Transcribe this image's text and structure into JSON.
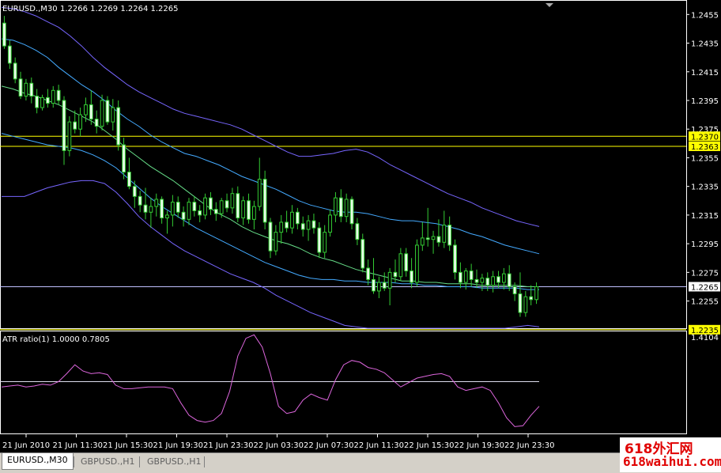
{
  "header": {
    "symbol_label": "EURUSD.,M30",
    "ohlc_text": "1.2266 1.2269 1.2264 1.2265"
  },
  "indicator": {
    "label": "ATR ratio(1) 1.0000 0.7805",
    "axis_label": "1.4104"
  },
  "price_axis": {
    "ticks": [
      "1.2455",
      "1.2435",
      "1.2415",
      "1.2395",
      "1.2375",
      "1.2355",
      "1.2335",
      "1.2315",
      "1.2295",
      "1.2275",
      "1.2255"
    ],
    "ylim": [
      1.2236,
      1.2464
    ]
  },
  "time_axis": {
    "labels": [
      "21 Jun 2010",
      "21 Jun 11:30",
      "21 Jun 15:30",
      "21 Jun 19:30",
      "21 Jun 23:30",
      "22 Jun 03:30",
      "22 Jun 07:30",
      "22 Jun 11:30",
      "22 Jun 15:30",
      "22 Jun 19:30",
      "22 Jun 23:30"
    ]
  },
  "horizontal_levels": [
    {
      "value": 1.237,
      "label": "1.2370",
      "color": "#ffff00"
    },
    {
      "value": 1.2363,
      "label": "1.2363",
      "color": "#ffff00"
    },
    {
      "value": 1.2265,
      "label": "1.2265",
      "color": "#c0c0ff"
    },
    {
      "value": 1.2235,
      "label": "1.2235",
      "color": "#ffff00"
    }
  ],
  "colors": {
    "background": "#000000",
    "candle_bull": "#000000",
    "candle_bear": "#e8ffe8",
    "wick": "#33cc33",
    "band_mid": "#66dd88",
    "band_inner": "#44aaff",
    "band_outer": "#7766ff",
    "indicator_line": "#dd66dd",
    "indicator_level": "#ddddee",
    "axis_text": "#ffffff"
  },
  "chart_data": {
    "type": "candlestick",
    "ylim": [
      1.2236,
      1.2464
    ],
    "candles": [
      [
        1.2449,
        1.2454,
        1.2431,
        1.2433
      ],
      [
        1.2433,
        1.2437,
        1.2417,
        1.2421
      ],
      [
        1.2421,
        1.2425,
        1.2407,
        1.241
      ],
      [
        1.241,
        1.2415,
        1.2396,
        1.2398
      ],
      [
        1.2398,
        1.241,
        1.2395,
        1.2407
      ],
      [
        1.2407,
        1.2411,
        1.2393,
        1.2398
      ],
      [
        1.2398,
        1.2403,
        1.2386,
        1.239
      ],
      [
        1.239,
        1.2399,
        1.2388,
        1.2397
      ],
      [
        1.2397,
        1.2403,
        1.239,
        1.2393
      ],
      [
        1.2393,
        1.2405,
        1.239,
        1.2402
      ],
      [
        1.2402,
        1.2406,
        1.2392,
        1.2395
      ],
      [
        1.2395,
        1.2398,
        1.235,
        1.236
      ],
      [
        1.236,
        1.2384,
        1.2356,
        1.238
      ],
      [
        1.238,
        1.2388,
        1.2372,
        1.2375
      ],
      [
        1.2375,
        1.239,
        1.237,
        1.2385
      ],
      [
        1.2385,
        1.2397,
        1.238,
        1.2392
      ],
      [
        1.2392,
        1.2402,
        1.2378,
        1.2382
      ],
      [
        1.2382,
        1.2388,
        1.2372,
        1.2377
      ],
      [
        1.2377,
        1.2399,
        1.2374,
        1.2395
      ],
      [
        1.2395,
        1.2398,
        1.2378,
        1.238
      ],
      [
        1.238,
        1.2396,
        1.2374,
        1.239
      ],
      [
        1.239,
        1.2395,
        1.236,
        1.2364
      ],
      [
        1.2364,
        1.2369,
        1.234,
        1.2345
      ],
      [
        1.2345,
        1.2355,
        1.2333,
        1.2335
      ],
      [
        1.2335,
        1.2339,
        1.232,
        1.2328
      ],
      [
        1.2328,
        1.2332,
        1.2317,
        1.2322
      ],
      [
        1.2322,
        1.2334,
        1.2312,
        1.2317
      ],
      [
        1.2317,
        1.2327,
        1.2306,
        1.2321
      ],
      [
        1.2321,
        1.233,
        1.2314,
        1.2326
      ],
      [
        1.2326,
        1.2328,
        1.2309,
        1.2313
      ],
      [
        1.2313,
        1.2318,
        1.2302,
        1.2315
      ],
      [
        1.2315,
        1.2329,
        1.2307,
        1.2324
      ],
      [
        1.2324,
        1.2328,
        1.2313,
        1.2317
      ],
      [
        1.2317,
        1.2321,
        1.2307,
        1.2312
      ],
      [
        1.2312,
        1.2327,
        1.2308,
        1.2324
      ],
      [
        1.2324,
        1.2328,
        1.2314,
        1.2318
      ],
      [
        1.2318,
        1.2322,
        1.231,
        1.2315
      ],
      [
        1.2315,
        1.233,
        1.2312,
        1.2327
      ],
      [
        1.2327,
        1.2331,
        1.2315,
        1.2319
      ],
      [
        1.2319,
        1.2324,
        1.2311,
        1.2316
      ],
      [
        1.2316,
        1.2327,
        1.2313,
        1.2325
      ],
      [
        1.2325,
        1.233,
        1.2317,
        1.232
      ],
      [
        1.232,
        1.2334,
        1.2316,
        1.233
      ],
      [
        1.233,
        1.2335,
        1.231,
        1.2313
      ],
      [
        1.2313,
        1.2328,
        1.2308,
        1.2325
      ],
      [
        1.2325,
        1.233,
        1.2309,
        1.2312
      ],
      [
        1.2312,
        1.2325,
        1.2305,
        1.2321
      ],
      [
        1.2321,
        1.2355,
        1.2318,
        1.234
      ],
      [
        1.234,
        1.2346,
        1.2305,
        1.231
      ],
      [
        1.231,
        1.2313,
        1.2285,
        1.229
      ],
      [
        1.229,
        1.2308,
        1.2287,
        1.2303
      ],
      [
        1.2303,
        1.2315,
        1.2295,
        1.231
      ],
      [
        1.231,
        1.2318,
        1.2303,
        1.2306
      ],
      [
        1.2306,
        1.2322,
        1.2302,
        1.2317
      ],
      [
        1.2317,
        1.232,
        1.2305,
        1.2309
      ],
      [
        1.2309,
        1.2314,
        1.23,
        1.2305
      ],
      [
        1.2305,
        1.2315,
        1.2297,
        1.2311
      ],
      [
        1.2311,
        1.2316,
        1.2302,
        1.2306
      ],
      [
        1.2306,
        1.231,
        1.2285,
        1.2289
      ],
      [
        1.2289,
        1.2308,
        1.2285,
        1.2303
      ],
      [
        1.2303,
        1.2319,
        1.23,
        1.2315
      ],
      [
        1.2315,
        1.2331,
        1.231,
        1.2327
      ],
      [
        1.2327,
        1.2333,
        1.231,
        1.2314
      ],
      [
        1.2314,
        1.233,
        1.231,
        1.2326
      ],
      [
        1.2326,
        1.2328,
        1.2305,
        1.2309
      ],
      [
        1.2309,
        1.2313,
        1.2294,
        1.2298
      ],
      [
        1.2298,
        1.2302,
        1.2275,
        1.2278
      ],
      [
        1.2278,
        1.2284,
        1.2266,
        1.227
      ],
      [
        1.227,
        1.2285,
        1.226,
        1.2262
      ],
      [
        1.2262,
        1.2272,
        1.2257,
        1.2268
      ],
      [
        1.2268,
        1.2275,
        1.2262,
        1.2264
      ],
      [
        1.2264,
        1.2278,
        1.2252,
        1.2275
      ],
      [
        1.2275,
        1.2284,
        1.2268,
        1.2272
      ],
      [
        1.2272,
        1.2292,
        1.2269,
        1.2288
      ],
      [
        1.2288,
        1.2292,
        1.2272,
        1.2276
      ],
      [
        1.2276,
        1.2285,
        1.2264,
        1.2268
      ],
      [
        1.2268,
        1.2298,
        1.2265,
        1.2294
      ],
      [
        1.2294,
        1.231,
        1.229,
        1.2299
      ],
      [
        1.2299,
        1.232,
        1.2293,
        1.2298
      ],
      [
        1.2298,
        1.2304,
        1.2288,
        1.23
      ],
      [
        1.23,
        1.2312,
        1.2293,
        1.2296
      ],
      [
        1.2296,
        1.2318,
        1.2292,
        1.2308
      ],
      [
        1.2308,
        1.2314,
        1.229,
        1.2294
      ],
      [
        1.2294,
        1.2298,
        1.227,
        1.2275
      ],
      [
        1.2275,
        1.2282,
        1.2264,
        1.2268
      ],
      [
        1.2268,
        1.2278,
        1.2263,
        1.2276
      ],
      [
        1.2276,
        1.2281,
        1.2265,
        1.227
      ],
      [
        1.227,
        1.2277,
        1.2264,
        1.2268
      ],
      [
        1.2268,
        1.2274,
        1.2262,
        1.2271
      ],
      [
        1.2271,
        1.2275,
        1.2262,
        1.2266
      ],
      [
        1.2266,
        1.2276,
        1.2261,
        1.2272
      ],
      [
        1.2272,
        1.2276,
        1.2264,
        1.2268
      ],
      [
        1.2268,
        1.2278,
        1.2263,
        1.2274
      ],
      [
        1.2274,
        1.228,
        1.2262,
        1.2265
      ],
      [
        1.2265,
        1.2268,
        1.2255,
        1.226
      ],
      [
        1.226,
        1.2275,
        1.2244,
        1.2247
      ],
      [
        1.2247,
        1.2262,
        1.2244,
        1.2258
      ],
      [
        1.2258,
        1.2266,
        1.2252,
        1.2256
      ],
      [
        1.2256,
        1.2268,
        1.2253,
        1.2265
      ]
    ],
    "bands": {
      "mid": [
        1.2405,
        1.2403,
        1.24,
        1.2398,
        1.2395,
        1.2392,
        1.2388,
        1.2384,
        1.238,
        1.2374,
        1.2368,
        1.2361,
        1.2355,
        1.2349,
        1.2344,
        1.2339,
        1.2333,
        1.2327,
        1.2321,
        1.2316,
        1.2312,
        1.2307,
        1.2303,
        1.23,
        1.2297,
        1.2295,
        1.2292,
        1.2288,
        1.2285,
        1.2283,
        1.228,
        1.2277,
        1.2275,
        1.2273,
        1.2271,
        1.2269,
        1.2269,
        1.2268,
        1.2268,
        1.2267,
        1.2267,
        1.2267,
        1.2266,
        1.2266,
        1.2266,
        1.2266,
        1.2265,
        1.2265
      ],
      "upper_inner": [
        1.2438,
        1.2437,
        1.2434,
        1.243,
        1.2425,
        1.2418,
        1.2412,
        1.2406,
        1.2401,
        1.2395,
        1.2388,
        1.2382,
        1.2377,
        1.2371,
        1.2366,
        1.2362,
        1.2358,
        1.2356,
        1.2353,
        1.235,
        1.2346,
        1.2342,
        1.2339,
        1.2336,
        1.2333,
        1.2329,
        1.2325,
        1.2322,
        1.232,
        1.2318,
        1.2317,
        1.2317,
        1.2316,
        1.2314,
        1.2312,
        1.2311,
        1.2311,
        1.231,
        1.2309,
        1.2307,
        1.2305,
        1.2302,
        1.23,
        1.2297,
        1.2294,
        1.2292,
        1.229,
        1.2288
      ],
      "lower_inner": [
        1.2372,
        1.237,
        1.2368,
        1.2366,
        1.2364,
        1.2363,
        1.2362,
        1.236,
        1.2357,
        1.2353,
        1.2348,
        1.2341,
        1.2334,
        1.2327,
        1.2321,
        1.2316,
        1.2311,
        1.2306,
        1.2302,
        1.2298,
        1.2294,
        1.229,
        1.2286,
        1.2282,
        1.2279,
        1.2276,
        1.2273,
        1.2271,
        1.227,
        1.227,
        1.2269,
        1.2269,
        1.2268,
        1.2268,
        1.2268,
        1.2267,
        1.2267,
        1.2266,
        1.2266,
        1.2265,
        1.2265,
        1.2265,
        1.2264,
        1.2264,
        1.2264,
        1.2264,
        1.2263,
        1.2263
      ],
      "upper_outer": [
        1.246,
        1.2459,
        1.2457,
        1.2454,
        1.245,
        1.2446,
        1.244,
        1.2433,
        1.2425,
        1.2418,
        1.2412,
        1.2406,
        1.2401,
        1.2397,
        1.2393,
        1.2389,
        1.2386,
        1.2384,
        1.2382,
        1.238,
        1.2378,
        1.2375,
        1.2371,
        1.2367,
        1.2363,
        1.2359,
        1.2356,
        1.2356,
        1.2357,
        1.2358,
        1.236,
        1.2361,
        1.2359,
        1.2355,
        1.235,
        1.2346,
        1.2342,
        1.2338,
        1.2334,
        1.233,
        1.2327,
        1.2324,
        1.232,
        1.2317,
        1.2314,
        1.2311,
        1.2309,
        1.2307
      ],
      "lower_outer": [
        1.2328,
        1.2328,
        1.2328,
        1.2331,
        1.2334,
        1.2336,
        1.2338,
        1.2339,
        1.2339,
        1.2337,
        1.2331,
        1.2323,
        1.2314,
        1.2307,
        1.2301,
        1.2295,
        1.229,
        1.2286,
        1.2282,
        1.2278,
        1.2274,
        1.2271,
        1.2268,
        1.2264,
        1.2259,
        1.2255,
        1.2251,
        1.2247,
        1.2244,
        1.2241,
        1.2238,
        1.2237,
        1.2236,
        1.2236,
        1.2236,
        1.2236,
        1.2236,
        1.2236,
        1.2236,
        1.2236,
        1.2236,
        1.2236,
        1.2236,
        1.2236,
        1.2236,
        1.2237,
        1.2238,
        1.2237
      ]
    },
    "indicator": {
      "values": [
        0.8,
        0.81,
        0.82,
        0.8,
        0.81,
        0.83,
        0.82,
        0.86,
        0.95,
        1.05,
        0.98,
        0.95,
        0.96,
        0.94,
        0.82,
        0.78,
        0.78,
        0.79,
        0.8,
        0.8,
        0.8,
        0.78,
        0.62,
        0.48,
        0.42,
        0.4,
        0.42,
        0.5,
        0.75,
        1.15,
        1.35,
        1.39,
        1.25,
        0.95,
        0.58,
        0.5,
        0.52,
        0.65,
        0.72,
        0.68,
        0.65,
        0.88,
        1.05,
        1.1,
        1.08,
        1.02,
        1.0,
        0.96,
        0.88,
        0.8,
        0.85,
        0.9,
        0.92,
        0.94,
        0.95,
        0.92,
        0.8,
        0.76,
        0.78,
        0.8,
        0.76,
        0.62,
        0.45,
        0.35,
        0.36,
        0.48,
        0.58
      ],
      "level": 0.86,
      "ylim": [
        0.3,
        1.4104
      ]
    }
  }
}
